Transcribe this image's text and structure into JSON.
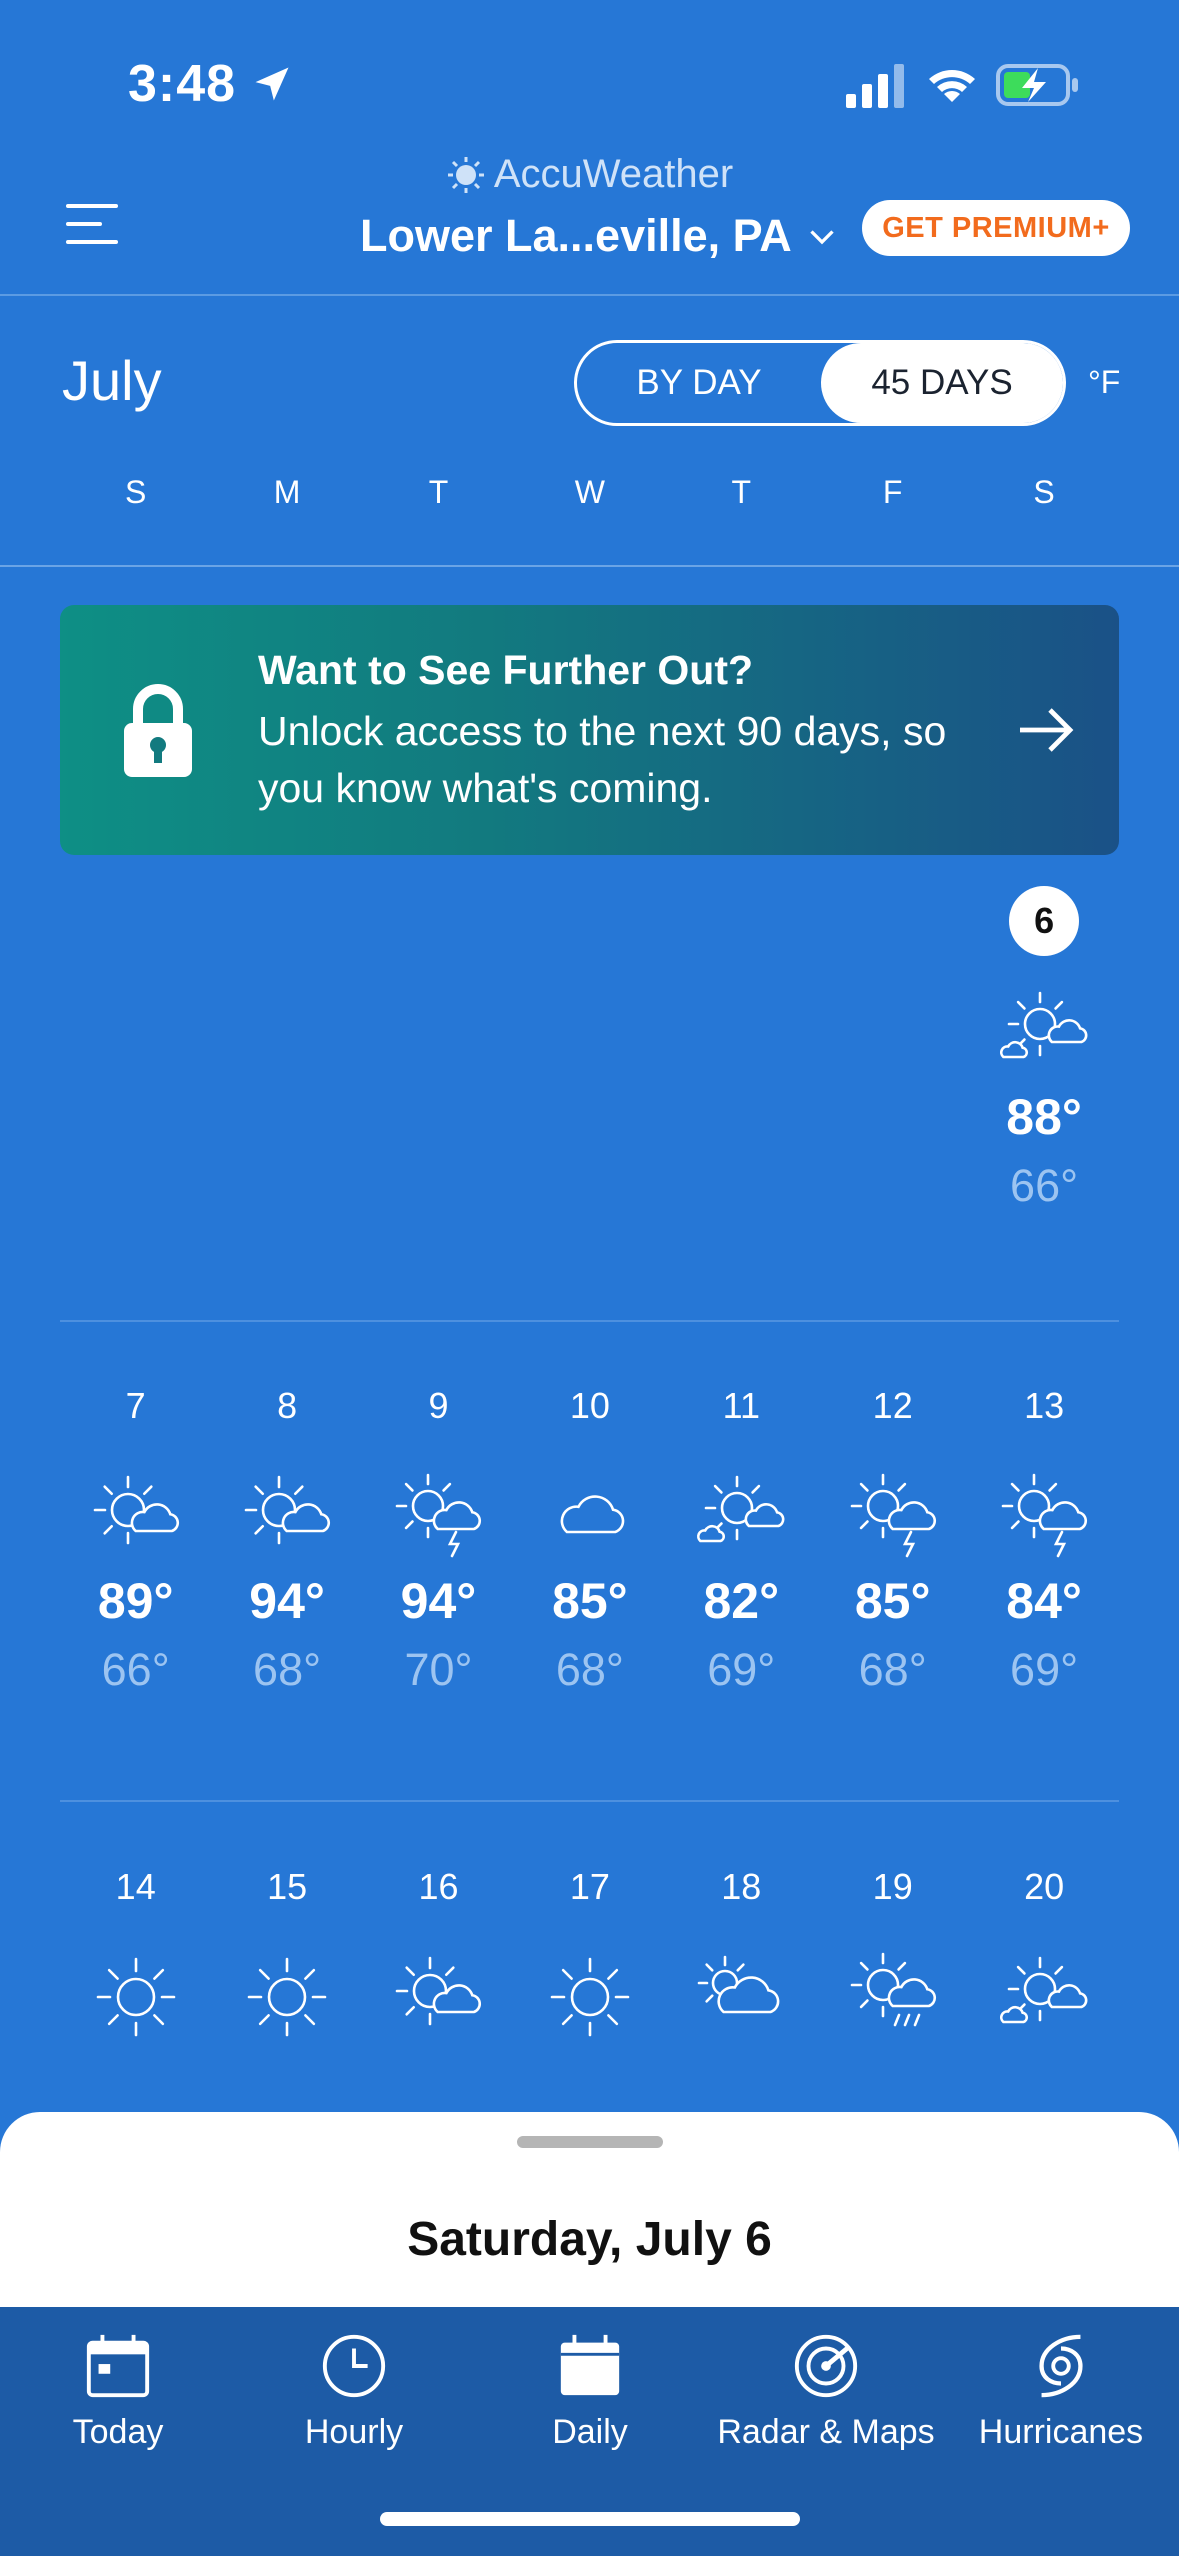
{
  "status_bar": {
    "time": "3:48"
  },
  "header": {
    "brand": "AccuWeather",
    "location": "Lower La...eville, PA",
    "premium_button": "GET PREMIUM+"
  },
  "calendar_header": {
    "month": "July",
    "toggle": {
      "by_day": "BY DAY",
      "days_45": "45 DAYS",
      "selected": "45 DAYS"
    },
    "unit": "°F",
    "weekdays": [
      "S",
      "M",
      "T",
      "W",
      "T",
      "F",
      "S"
    ]
  },
  "promo": {
    "title": "Want to See Further Out?",
    "body": "Unlock access to the next 90 days, so you know what's coming."
  },
  "weeks": [
    [
      {
        "day": "6",
        "icon": "partly-sunny-clouds-icon",
        "high": "88°",
        "low": "66°",
        "selected": true,
        "col": 6
      }
    ],
    [
      {
        "day": "7",
        "icon": "partly-sunny-icon",
        "high": "89°",
        "low": "66°"
      },
      {
        "day": "8",
        "icon": "partly-sunny-icon",
        "high": "94°",
        "low": "68°"
      },
      {
        "day": "9",
        "icon": "sun-thunderstorm-icon",
        "high": "94°",
        "low": "70°"
      },
      {
        "day": "10",
        "icon": "cloudy-icon",
        "high": "85°",
        "low": "68°"
      },
      {
        "day": "11",
        "icon": "partly-sunny-clouds-icon",
        "high": "82°",
        "low": "69°"
      },
      {
        "day": "12",
        "icon": "sun-thunderstorm-icon",
        "high": "85°",
        "low": "68°"
      },
      {
        "day": "13",
        "icon": "sun-thunderstorm-icon",
        "high": "84°",
        "low": "69°"
      }
    ],
    [
      {
        "day": "14",
        "icon": "sunny-icon"
      },
      {
        "day": "15",
        "icon": "sunny-icon"
      },
      {
        "day": "16",
        "icon": "partly-sunny-icon"
      },
      {
        "day": "17",
        "icon": "sunny-icon"
      },
      {
        "day": "18",
        "icon": "mostly-cloudy-icon"
      },
      {
        "day": "19",
        "icon": "sun-showers-icon"
      },
      {
        "day": "20",
        "icon": "partly-sunny-clouds-icon"
      }
    ]
  ],
  "bottom_sheet": {
    "title": "Saturday, July 6"
  },
  "tabs": [
    {
      "label": "Today",
      "icon": "calendar-today-icon"
    },
    {
      "label": "Hourly",
      "icon": "clock-icon"
    },
    {
      "label": "Daily",
      "icon": "calendar-daily-icon"
    },
    {
      "label": "Radar & Maps",
      "icon": "radar-icon"
    },
    {
      "label": "Hurricanes",
      "icon": "hurricane-icon"
    }
  ],
  "colors": {
    "background": "#2677d6",
    "tabbar": "#1d5ba6",
    "premium_text": "#f26b1d"
  }
}
